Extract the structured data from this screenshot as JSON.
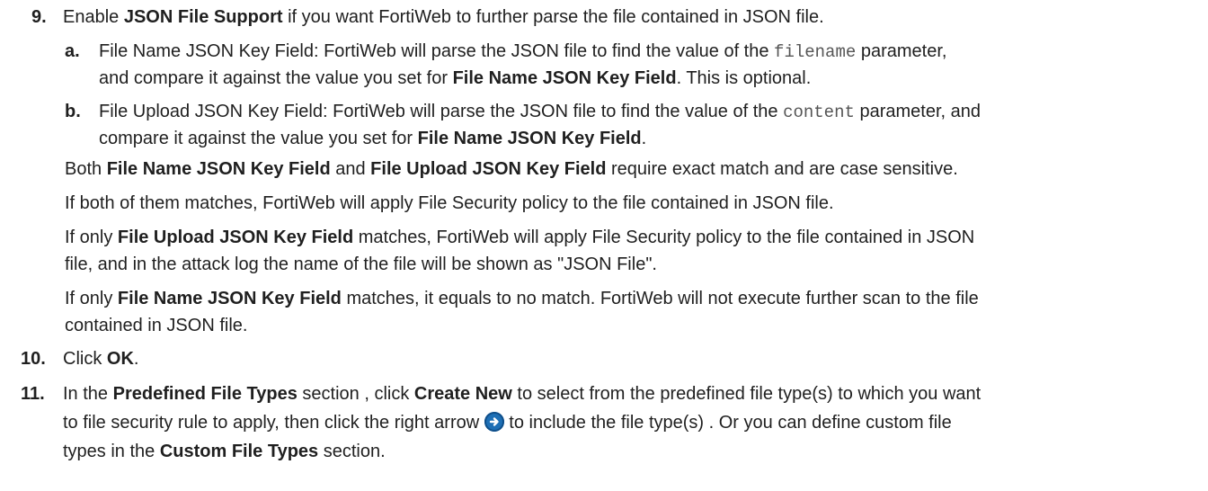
{
  "steps": {
    "s9": {
      "num": "9.",
      "t1": "Enable ",
      "b1": "JSON File Support",
      "t2": " if you want FortiWeb to further parse the file contained in JSON file."
    },
    "s9a": {
      "num": "a.",
      "l1_t1": "File Name JSON Key Field: FortiWeb will parse the JSON file to find the value of the ",
      "l1_code": "filename",
      "l1_t2": " parameter,",
      "l2_t1": "and compare it against the value you set for ",
      "l2_b1": "File Name JSON Key Field",
      "l2_t2": ". This is optional."
    },
    "s9b": {
      "num": "b.",
      "l1_t1": "File Upload JSON Key Field: FortiWeb will parse the JSON file to find the value of the ",
      "l1_code": "content",
      "l1_t2": " parameter, and",
      "l2_t1": "compare it against the value you set for ",
      "l2_b1": "File Name JSON Key Field",
      "l2_t2": "."
    },
    "p1": {
      "t1": "Both ",
      "b1": "File Name JSON Key Field",
      "t2": " and ",
      "b2": "File Upload JSON Key Field",
      "t3": " require exact match and are case sensitive."
    },
    "p2": {
      "t1": "If both of them matches, FortiWeb will apply File Security policy to the file contained in JSON file."
    },
    "p3": {
      "l1_t1": "If only ",
      "l1_b1": "File Upload JSON Key Field",
      "l1_t2": " matches, FortiWeb will apply File Security policy to the file contained in JSON",
      "l2_t1": "file, and in the attack log the name of the file will be shown as \"JSON File\"."
    },
    "p4": {
      "l1_t1": "If only ",
      "l1_b1": "File Name JSON Key Field",
      "l1_t2": " matches, it equals to no match. FortiWeb will not execute further scan to the file",
      "l2_t1": "contained in JSON file."
    },
    "s10": {
      "num": "10.",
      "t1": "Click ",
      "b1": "OK",
      "t2": "."
    },
    "s11": {
      "num": "11.",
      "l1_t1": "In the ",
      "l1_b1": "Predefined File Types",
      "l1_t2": " section , click ",
      "l1_b2": "Create New",
      "l1_t3": " to select from the predefined file type(s) to which you want",
      "l2_t1": "to file security rule to apply, then click the right arrow ",
      "l2_t2": " to include the file type(s) . Or you can define custom file",
      "l3_t1": "types in the ",
      "l3_b1": "Custom File Types",
      "l3_t2": " section."
    }
  }
}
